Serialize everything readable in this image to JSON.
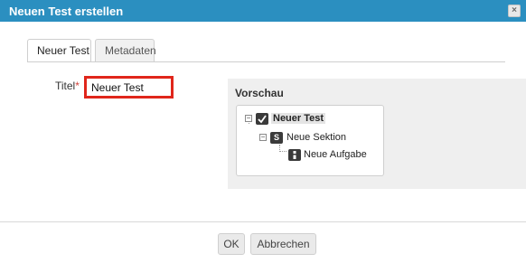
{
  "dialog": {
    "title": "Neuen Test erstellen",
    "close_glyph": "×"
  },
  "tabs": [
    {
      "label": "Neuer Test",
      "active": true
    },
    {
      "label": "Metadaten",
      "active": false
    }
  ],
  "form": {
    "title_label": "Titel",
    "required_marker": "*",
    "title_value": "Neuer Test"
  },
  "preview": {
    "heading": "Vorschau",
    "tree": {
      "root": {
        "label": "Neuer Test",
        "icon": "test-icon",
        "toggle": "⊟"
      },
      "section": {
        "label": "Neue Sektion",
        "icon": "section-icon",
        "icon_letter": "S",
        "toggle": "⊟"
      },
      "item": {
        "label": "Neue Aufgabe",
        "icon": "task-icon"
      }
    }
  },
  "buttons": {
    "ok": "OK",
    "cancel": "Abbrechen"
  },
  "colors": {
    "titlebar": "#2b8fc0",
    "highlight_border": "#e0261b",
    "required": "#d0413a",
    "icon_dark": "#3a3a3a"
  }
}
